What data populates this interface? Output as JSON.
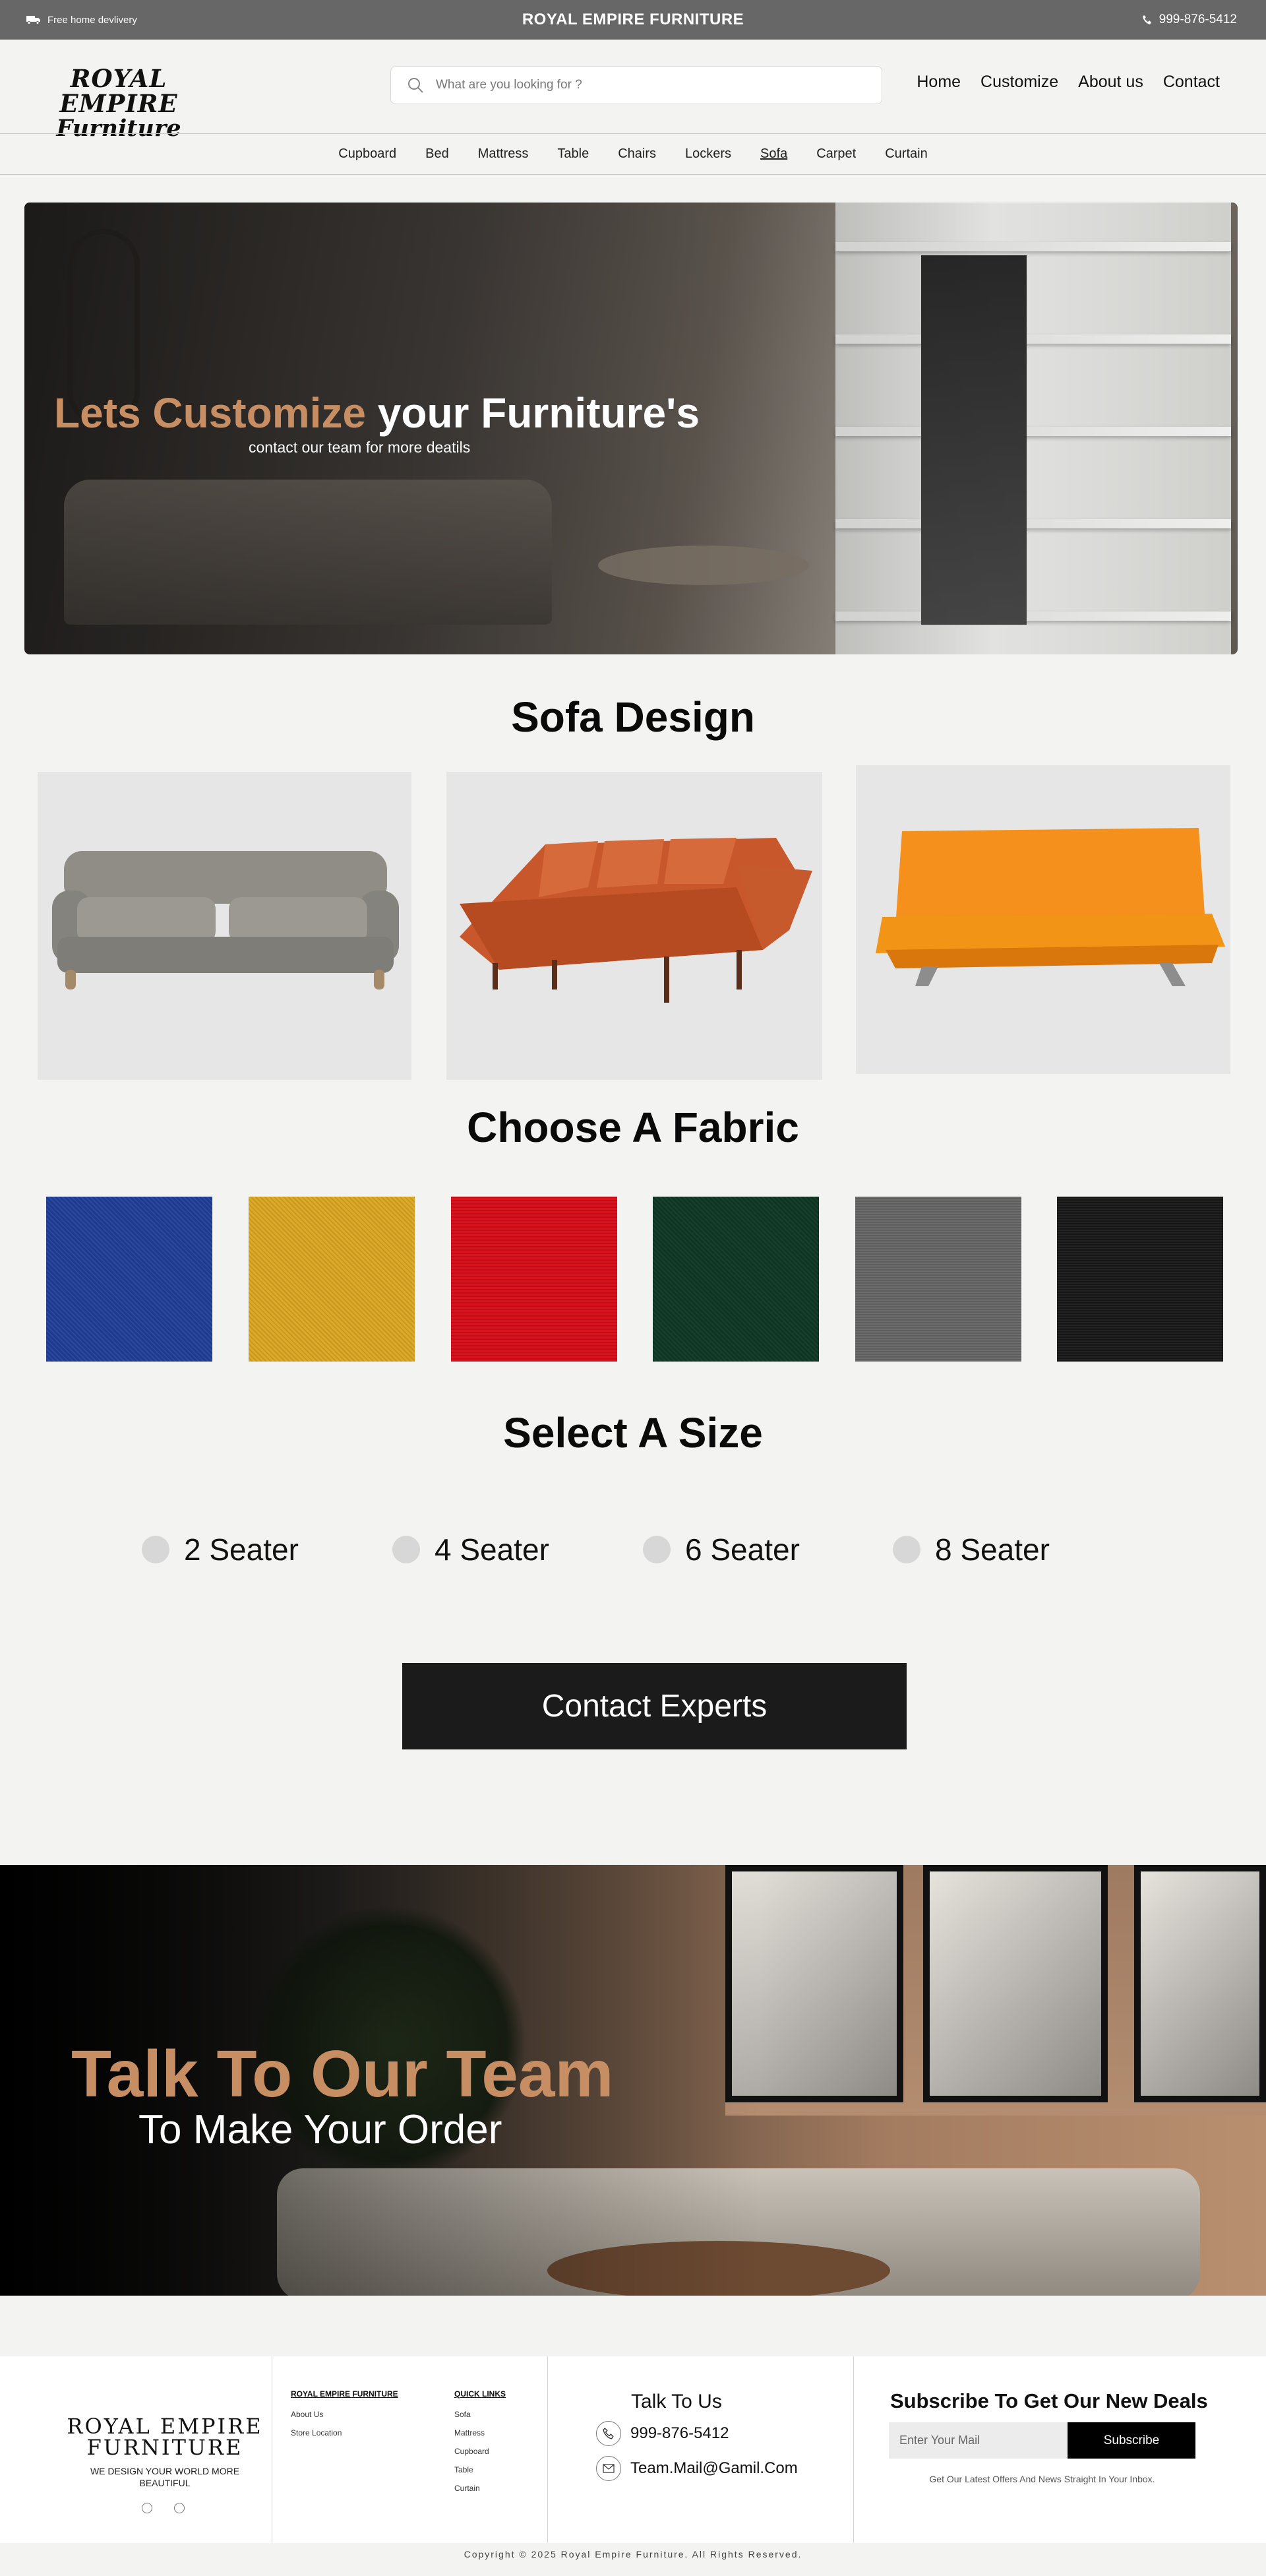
{
  "topbar": {
    "delivery": "Free home devlivery",
    "brand": "ROYAL EMPIRE  FURNITURE",
    "phone": "999-876-5412"
  },
  "header": {
    "logo_line1": "ROYAL EMPIRE",
    "logo_line2": "Furniture",
    "search_placeholder": "What are you looking for ?",
    "nav": [
      "Home",
      "Customize",
      "About us",
      "Contact"
    ]
  },
  "categories": {
    "items": [
      "Cupboard",
      "Bed",
      "Mattress",
      "Table",
      "Chairs",
      "Lockers",
      "Sofa",
      "Carpet",
      "Curtain"
    ],
    "active": "Sofa"
  },
  "hero": {
    "title_accent": "Lets Customize",
    "title_rest": " your Furniture's",
    "subtitle": "contact our team for more deatils"
  },
  "design": {
    "title": "Sofa Design",
    "sofas": [
      {
        "name": "grey-classic-sofa",
        "color": "#8f8d86"
      },
      {
        "name": "leather-orange-sofa",
        "color": "#c8572c"
      },
      {
        "name": "orange-futon-sofa",
        "color": "#f4901b"
      }
    ]
  },
  "fabric": {
    "title": "Choose A Fabric",
    "swatches": [
      {
        "name": "blue",
        "color": "#1f3a8c"
      },
      {
        "name": "yellow",
        "color": "#dcaa2a"
      },
      {
        "name": "red",
        "color": "#d9121d"
      },
      {
        "name": "green",
        "color": "#0f3423"
      },
      {
        "name": "grey",
        "color": "#6c6c6c"
      },
      {
        "name": "black",
        "color": "#161616"
      }
    ]
  },
  "size": {
    "title": "Select A Size",
    "options": [
      "2 Seater",
      "4 Seater",
      "6 Seater",
      "8 Seater"
    ]
  },
  "cta": {
    "label": "Contact Experts"
  },
  "team": {
    "title": "Talk To Our Team",
    "subtitle": "To Make Your Order"
  },
  "footer": {
    "logo_line1": "ROYAL EMPIRE",
    "logo_line2": "FURNITURE",
    "tagline": "WE DESIGN YOUR WORLD MORE BEAUTIFUL",
    "col1": {
      "title": "ROYAL EMPIRE FURNITURE",
      "links": [
        "About Us",
        "Store Location"
      ]
    },
    "col2": {
      "title": "QUICK LINKS",
      "links": [
        "Sofa",
        "Mattress",
        "Cupboard",
        "Table",
        "Curtain"
      ]
    },
    "talk_title": "Talk To Us",
    "phone": "999-876-5412",
    "email": "Team.Mail@Gamil.Com",
    "subscribe_title": "Subscribe To Get Our New Deals",
    "subscribe_placeholder": "Enter Your Mail",
    "subscribe_button": "Subscribe",
    "subscribe_note": "Get Our Latest Offers And News Straight In Your Inbox.",
    "copyright": "Copyright © 2025 Royal Empire Furniture. All Rights Reserved."
  },
  "colors": {
    "accent": "#c78d63",
    "topbar": "#676767",
    "cta": "#1b1b1b",
    "background": "#f3f3f1"
  }
}
